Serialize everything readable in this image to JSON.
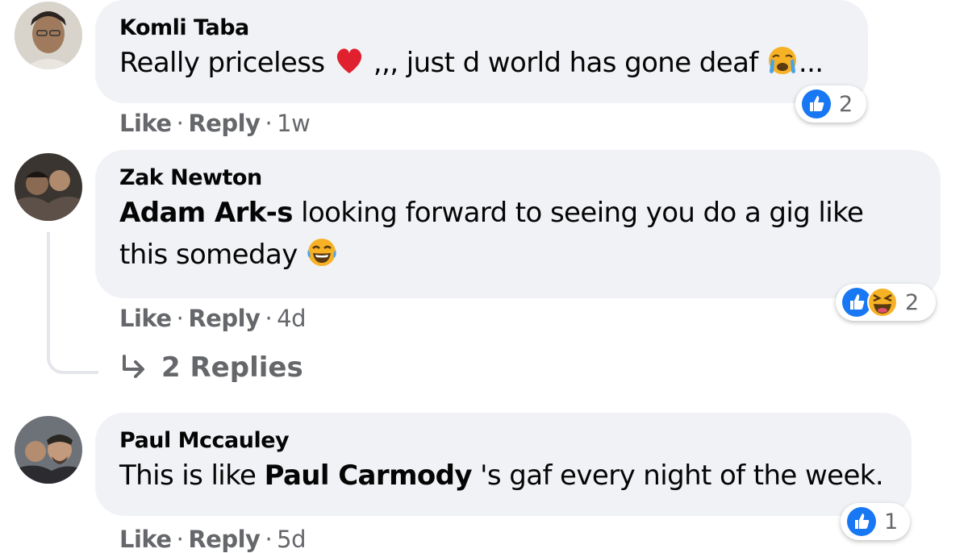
{
  "comments": [
    {
      "author": "Komli Taba",
      "text_before": "Really priceless",
      "text_middle": " ,,, just d world has gone deaf ",
      "text_after": "...",
      "emoji_1": "red-heart",
      "emoji_2": "crying-face",
      "actions": {
        "like": "Like",
        "reply": "Reply",
        "time": "1w",
        "sep": "·"
      },
      "reactions": {
        "icons": [
          "like"
        ],
        "count": "2"
      }
    },
    {
      "author": "Zak Newton",
      "mention": "Adam Ark-s",
      "text": " looking forward to seeing you do a gig like this someday ",
      "emoji": "tears-of-joy",
      "actions": {
        "like": "Like",
        "reply": "Reply",
        "time": "4d",
        "sep": "·"
      },
      "reactions": {
        "icons": [
          "like",
          "haha"
        ],
        "count": "2"
      },
      "replies_label": "2 Replies"
    },
    {
      "author": "Paul Mccauley",
      "text_before": "This is like ",
      "mention": "Paul Carmody",
      "text_after": " 's gaf every night of the week.",
      "actions": {
        "like": "Like",
        "reply": "Reply",
        "time": "5d",
        "sep": "·"
      },
      "reactions": {
        "icons": [
          "like"
        ],
        "count": "1"
      }
    }
  ],
  "colors": {
    "bubble": "#f0f2f5",
    "like_blue": "#1877f2",
    "meta_gray": "#65676b",
    "haha_yellow": "#f7b125"
  }
}
